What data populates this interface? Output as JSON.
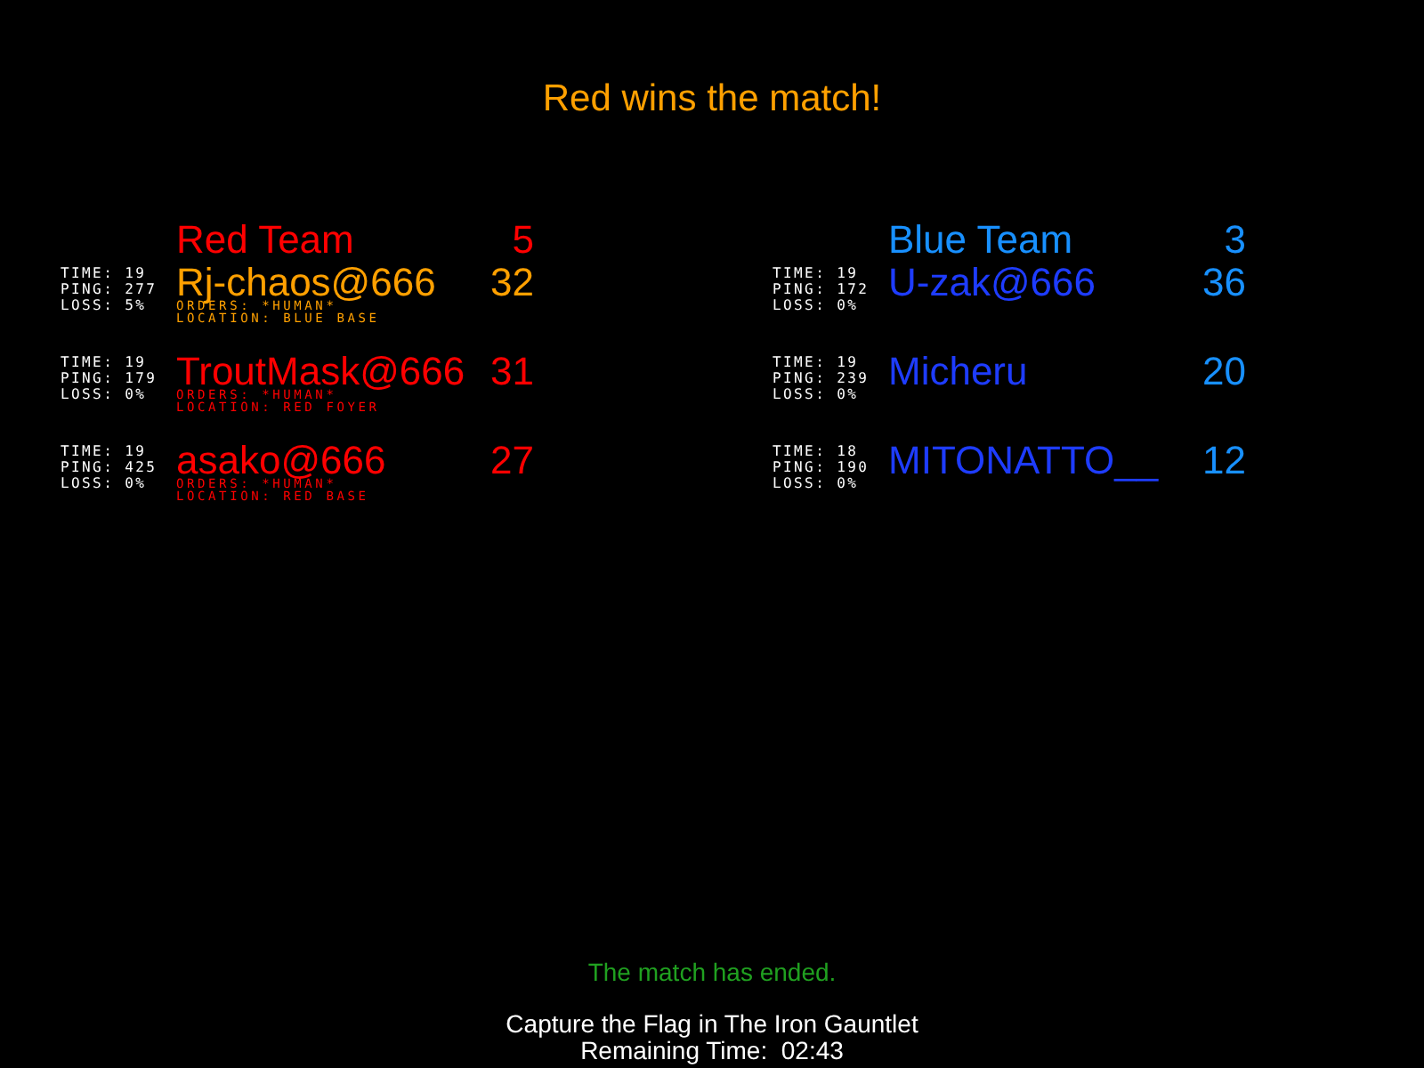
{
  "title": "Red wins the match!",
  "teams": [
    {
      "name": "Red Team",
      "score": "5",
      "color": "#ff0000",
      "players": [
        {
          "name": "Rj-chaos@666",
          "score": "32",
          "color": "#ffa000",
          "highlighted": true,
          "stats": [
            "TIME: 19",
            "PING: 277",
            "LOSS: 5%"
          ],
          "orders": "ORDERS: *HUMAN*",
          "location": "LOCATION: BLUE BASE"
        },
        {
          "name": "TroutMask@666",
          "score": "31",
          "color": "#ff0000",
          "highlighted": false,
          "stats": [
            "TIME: 19",
            "PING: 179",
            "LOSS: 0%"
          ],
          "orders": "ORDERS: *HUMAN*",
          "location": "LOCATION: RED FOYER"
        },
        {
          "name": "asako@666",
          "score": "27",
          "color": "#ff0000",
          "highlighted": false,
          "stats": [
            "TIME: 19",
            "PING: 425",
            "LOSS: 0%"
          ],
          "orders": "ORDERS: *HUMAN*",
          "location": "LOCATION: RED BASE"
        }
      ]
    },
    {
      "name": "Blue Team",
      "score": "3",
      "color": "#1890ff",
      "players": [
        {
          "name": "U-zak@666",
          "score": "36",
          "color": "#1e3cff",
          "highlighted": false,
          "stats": [
            "TIME: 19",
            "PING: 172",
            "LOSS: 0%"
          ]
        },
        {
          "name": "Micheru",
          "score": "20",
          "color": "#1e3cff",
          "highlighted": false,
          "stats": [
            "TIME: 19",
            "PING: 239",
            "LOSS: 0%"
          ]
        },
        {
          "name": "MITONATTO__",
          "score": "12",
          "color": "#1e3cff",
          "highlighted": false,
          "stats": [
            "TIME: 18",
            "PING: 190",
            "LOSS: 0%"
          ]
        }
      ]
    }
  ],
  "status": "The match has ended.",
  "game_mode": "Capture the Flag in The Iron Gauntlet",
  "remaining_time": "Remaining Time:  02:43"
}
